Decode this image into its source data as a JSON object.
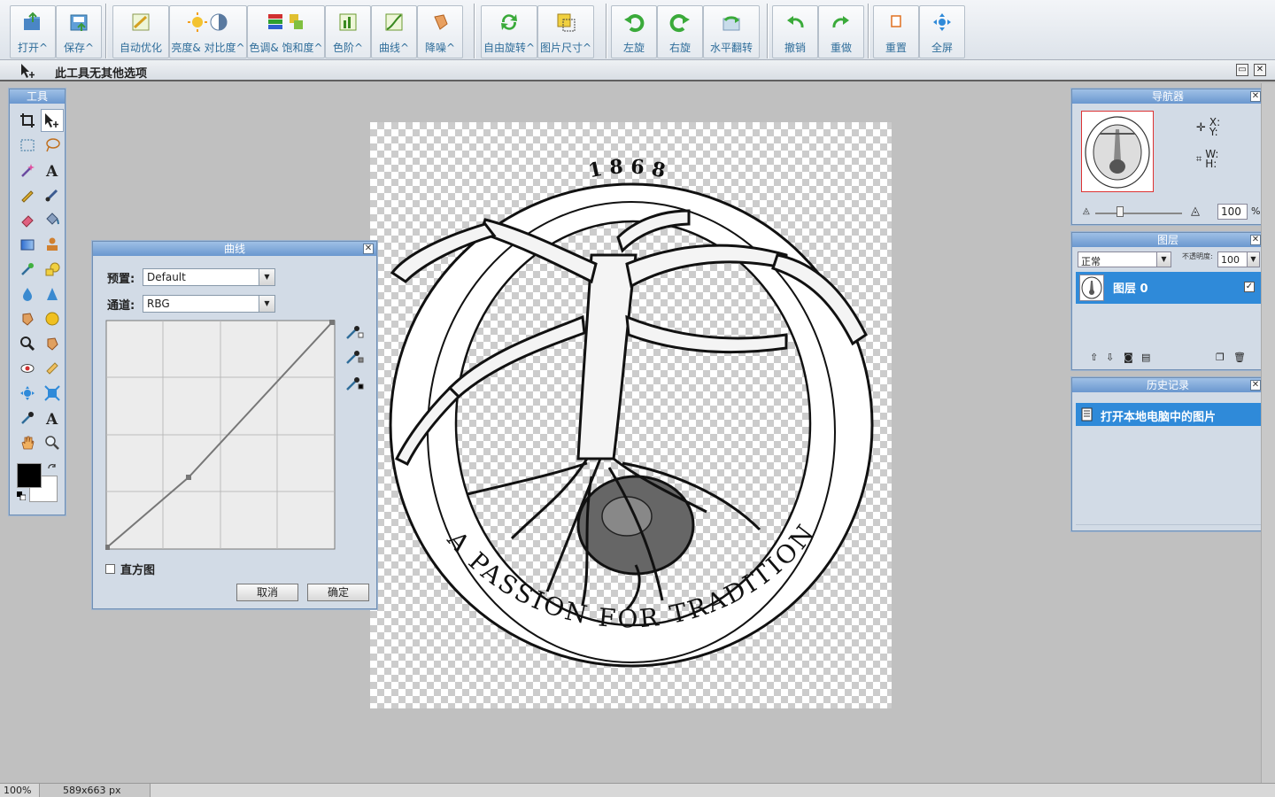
{
  "toolbar": {
    "buttons": [
      {
        "label": "打开^",
        "icon": "open-folder-icon"
      },
      {
        "label": "保存^",
        "icon": "save-icon"
      },
      {
        "label": "自动优化",
        "icon": "auto-enhance-icon"
      },
      {
        "label": "亮度& 对比度^",
        "icon": "brightness-icon"
      },
      {
        "label": "色调& 饱和度^",
        "icon": "hue-saturation-icon"
      },
      {
        "label": "色阶^",
        "icon": "levels-icon"
      },
      {
        "label": "曲线^",
        "icon": "curves-icon"
      },
      {
        "label": "降噪^",
        "icon": "denoise-icon"
      },
      {
        "label": "自由旋转^",
        "icon": "free-rotate-icon"
      },
      {
        "label": "图片尺寸^",
        "icon": "image-size-icon"
      },
      {
        "label": "左旋",
        "icon": "rotate-left-icon"
      },
      {
        "label": "右旋",
        "icon": "rotate-right-icon"
      },
      {
        "label": "水平翻转",
        "icon": "flip-horizontal-icon"
      },
      {
        "label": "撤销",
        "icon": "undo-icon"
      },
      {
        "label": "重做",
        "icon": "redo-icon"
      },
      {
        "label": "重置",
        "icon": "reset-icon"
      },
      {
        "label": "全屏",
        "icon": "fullscreen-icon"
      }
    ]
  },
  "optbar": {
    "text": "此工具无其他选项"
  },
  "tools": {
    "title": "工具"
  },
  "curves": {
    "title": "曲线",
    "preset_label": "预置:",
    "preset_value": "Default",
    "channel_label": "通道:",
    "channel_value": "RBG",
    "histogram_label": "直方图",
    "cancel": "取消",
    "ok": "确定"
  },
  "navigator": {
    "title": "导航器",
    "x_label": "X:",
    "y_label": "Y:",
    "w_label": "W:",
    "h_label": "H:",
    "zoom": "100",
    "percent": "%"
  },
  "layers": {
    "title": "图层",
    "blend_mode": "正常",
    "opacity_label": "不透明度:",
    "opacity_value": "100",
    "layer_name": "图层 0"
  },
  "history": {
    "title": "历史记录",
    "item": "打开本地电脑中的图片"
  },
  "status": {
    "zoom": "100%",
    "size": "589x663 px"
  },
  "artwork": {
    "year": "1 8 6 8",
    "motto": "A PASSION FOR TRADITION"
  },
  "colors": {
    "accent": "#2f8ad9",
    "panel_title": "#6a97cf",
    "toolbar_label": "#2f6d9a"
  }
}
